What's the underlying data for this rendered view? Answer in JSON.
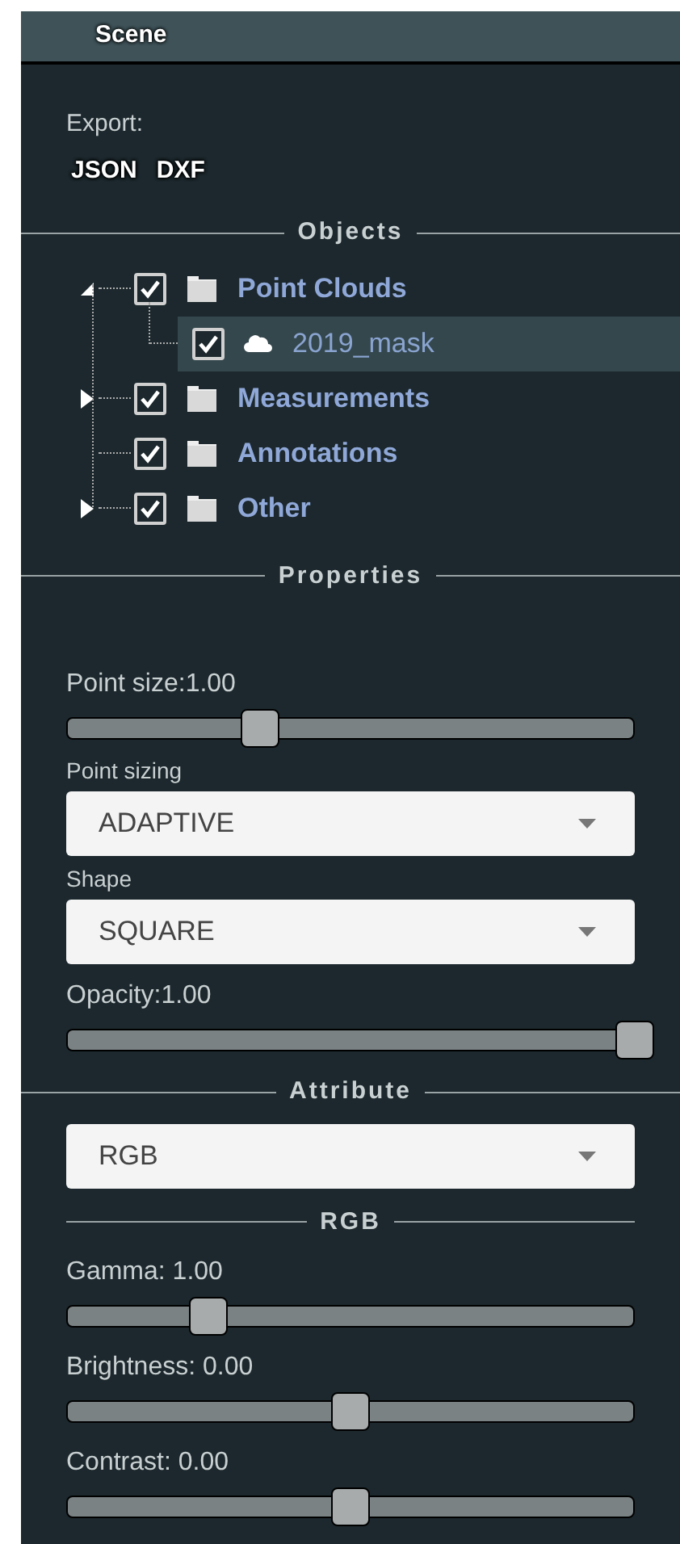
{
  "header": {
    "title": "Scene"
  },
  "export": {
    "label": "Export:",
    "buttons": [
      "JSON",
      "DXF"
    ]
  },
  "objects": {
    "title": "Objects",
    "tree": [
      {
        "label": "Point Clouds",
        "kind": "folder",
        "checked": true,
        "expanded": true,
        "children": [
          {
            "label": "2019_mask",
            "kind": "cloud",
            "checked": true,
            "selected": true
          }
        ]
      },
      {
        "label": "Measurements",
        "kind": "folder",
        "checked": true,
        "expanded": false
      },
      {
        "label": "Annotations",
        "kind": "folder",
        "checked": true
      },
      {
        "label": "Other",
        "kind": "folder",
        "checked": true,
        "expanded": false
      }
    ]
  },
  "properties": {
    "title": "Properties",
    "controls": [
      {
        "kind": "slider",
        "label": "Point size:1.00",
        "level": 0.34
      },
      {
        "kind": "select",
        "label": "Point sizing",
        "value": "ADAPTIVE"
      },
      {
        "kind": "select",
        "label": "Shape",
        "value": "SQUARE"
      },
      {
        "kind": "slider",
        "label": "Opacity:1.00",
        "level": 1.0
      }
    ]
  },
  "attribute": {
    "title": "Attribute",
    "value": "RGB",
    "subtitle": "RGB",
    "controls": [
      {
        "kind": "slider",
        "label": "Gamma: 1.00",
        "level": 0.25
      },
      {
        "kind": "slider",
        "label": "Brightness: 0.00",
        "level": 0.5
      },
      {
        "kind": "slider",
        "label": "Contrast: 0.00",
        "level": 0.5
      }
    ]
  }
}
